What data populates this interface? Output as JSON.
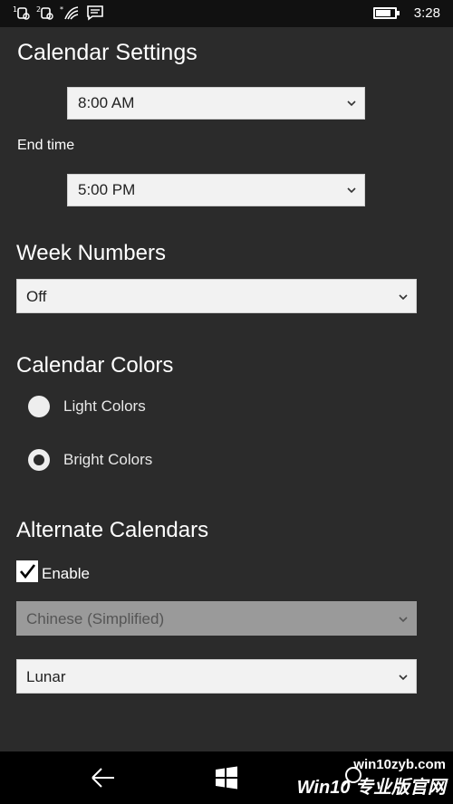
{
  "status_bar": {
    "time": "3:28",
    "icons": [
      "missed-call-icon",
      "missed-call-icon",
      "wifi-icon",
      "message-icon",
      "battery-icon"
    ]
  },
  "header": {
    "title": "Calendar Settings"
  },
  "start_time": {
    "value": "8:00 AM"
  },
  "end_time": {
    "label": "End time",
    "value": "5:00 PM"
  },
  "week_numbers": {
    "heading": "Week Numbers",
    "value": "Off"
  },
  "calendar_colors": {
    "heading": "Calendar Colors",
    "options": [
      {
        "label": "Light Colors",
        "selected": false
      },
      {
        "label": "Bright Colors",
        "selected": true
      }
    ]
  },
  "alternate_calendars": {
    "heading": "Alternate Calendars",
    "enable_label": "Enable",
    "enabled": true,
    "language_value": "Chinese (Simplified)",
    "calendar_value": "Lunar"
  },
  "watermark": {
    "top": "win10zyb.com",
    "bottom": "Win10 专业版官网"
  },
  "nav": {
    "icons": [
      "back-icon",
      "windows-icon",
      "search-icon"
    ]
  }
}
